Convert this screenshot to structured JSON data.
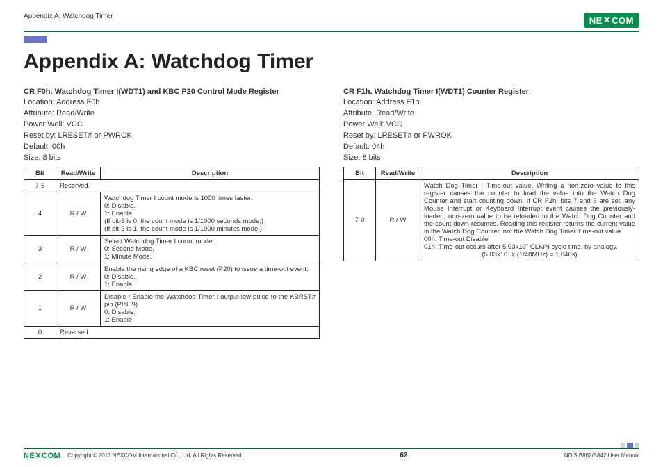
{
  "header": {
    "breadcrumb": "Appendix A: Watchdog Timer",
    "logo_text": "NE COM",
    "logo_x": "X"
  },
  "title": "Appendix A: Watchdog Timer",
  "left": {
    "reg_title": "CR F0h. Watchdog Timer I(WDT1) and KBC P20 Control Mode Register",
    "meta": {
      "location": "Location: Address F0h",
      "attribute": "Attribute: Read/Write",
      "power": "Power Well: VCC",
      "reset": "Reset by: LRESET# or PWROK",
      "default": "Default: 00h",
      "size": "Size: 8 bits"
    },
    "table": {
      "headers": {
        "bit": "Bit",
        "rw": "Read/Write",
        "desc": "Description"
      },
      "rows": [
        {
          "bit": "7-5",
          "rw": "",
          "desc_span_rw": true,
          "desc": [
            "Reserved."
          ]
        },
        {
          "bit": "4",
          "rw": "R / W",
          "desc": [
            "Watchdog Timer I count mode is 1000 times faster.",
            "0: Disable.",
            "1: Enable.",
            "(If bit-3 is 0, the count mode is 1/1000 seconds mode.)",
            "(If bit-3 is 1, the count mode is 1/1000 minutes mode.)"
          ]
        },
        {
          "bit": "3",
          "rw": "R / W",
          "desc": [
            "Select Watchdog Timer I count mode.",
            "0: Second Mode.",
            "1: Minute Mode."
          ]
        },
        {
          "bit": "2",
          "rw": "R / W",
          "desc": [
            "Enable the rising edge of a KBC reset (P20) to issue a time-out event.",
            "0: Disable.",
            "1: Enable."
          ]
        },
        {
          "bit": "1",
          "rw": "R / W",
          "desc": [
            "Disable / Enable the Watchdog Timer I output low pulse to the KBRST# pin (PIN59)",
            "0: Disable.",
            "1: Enable."
          ]
        },
        {
          "bit": "0",
          "rw": "",
          "desc_span_rw": true,
          "desc": [
            "Reversed"
          ]
        }
      ]
    }
  },
  "right": {
    "reg_title": "CR F1h. Watchdog Timer I(WDT1) Counter Register",
    "meta": {
      "location": "Location: Address F1h",
      "attribute": "Attribute: Read/Write",
      "power": "Power Well: VCC",
      "reset": "Reset by: LRESET# or PWROK",
      "default": "Default: 04h",
      "size": "Size: 8 bits"
    },
    "table": {
      "headers": {
        "bit": "Bit",
        "rw": "Read/Write",
        "desc": "Description"
      },
      "rows": [
        {
          "bit": "7-0",
          "rw": "R / W",
          "desc": [
            "Watch Dog Timer I Time-out value. Writing a non-zero value to this register causes the counter to load the value into the Watch Dog Counter and start counting down. If CR F2h, bits 7 and 6 are set, any Mouse Interrupt or Keyboard Interrupt event causes the previously-loaded, non-zero value to be reloaded to the Watch Dog Counter and the count down resumes. Reading this register returns the current value in the Watch Dog Counter, not the Watch Dog Timer Time-out value.",
            "00h: Time-out Disable",
            "01h: Time-out occurs after 5.03x10⁷ CLKIN cycle time, by analogy.",
            "(5.03x10⁷ x (1/48MHz) = 1.046s)"
          ]
        }
      ]
    }
  },
  "footer": {
    "logo": "NEXCOM",
    "copyright": "Copyright © 2013 NEXCOM International Co., Ltd. All Rights Reserved.",
    "page": "62",
    "doc": "NDiS B862/B842 User Manual"
  }
}
